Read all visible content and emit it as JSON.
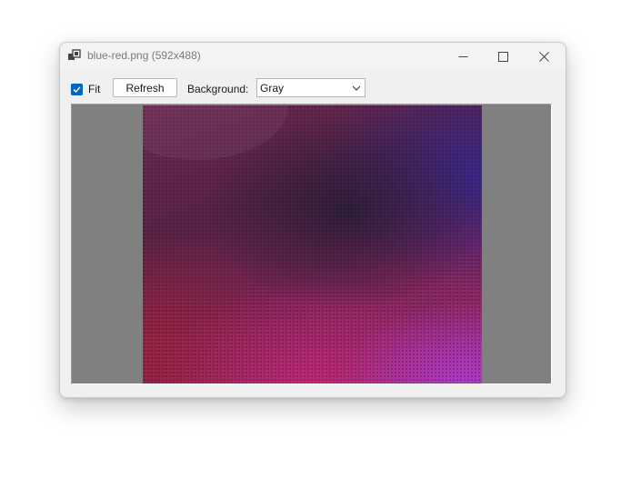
{
  "window": {
    "title": "blue-red.png (592x488)",
    "icons": {
      "app": "app-icon",
      "minimize": "minimize-icon",
      "maximize": "maximize-icon",
      "close": "close-icon"
    }
  },
  "toolbar": {
    "fit_label": "Fit",
    "fit_checked": true,
    "refresh_label": "Refresh",
    "background_label": "Background:",
    "background_value": "Gray"
  },
  "colors": {
    "accent": "#0067c0",
    "viewport_background": "#808080"
  }
}
